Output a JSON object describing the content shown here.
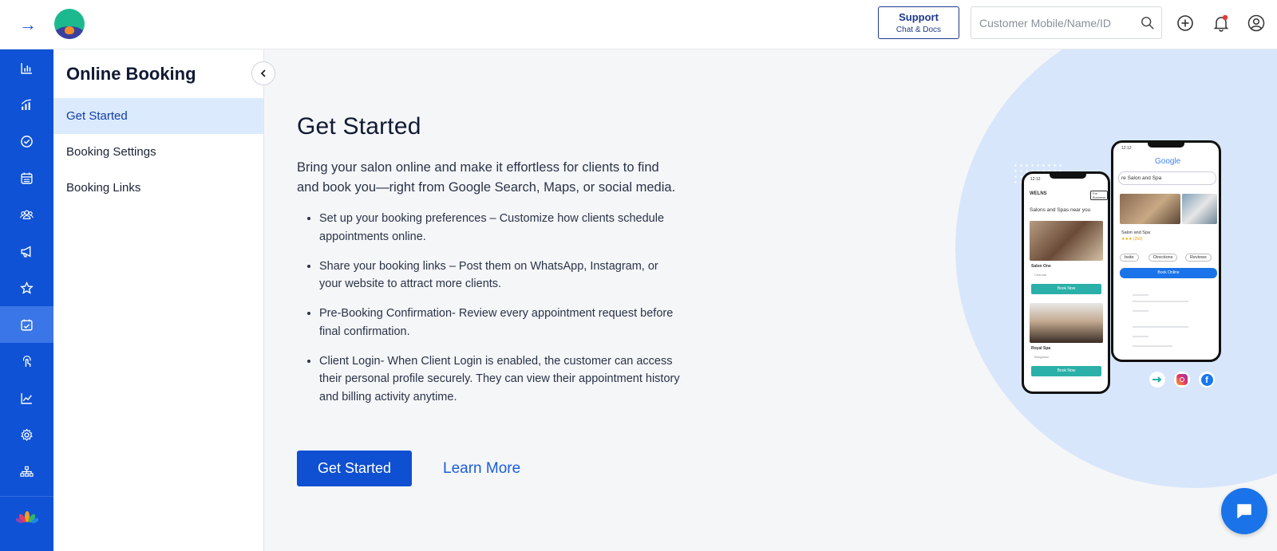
{
  "header": {
    "support_title": "Support",
    "support_sub": "Chat & Docs",
    "search_placeholder": "Customer Mobile/Name/ID",
    "icons": [
      "arrow-right-icon",
      "app-logo",
      "search-icon",
      "add-circle-icon",
      "bell-icon",
      "user-icon"
    ],
    "notification_dot_color": "#e53935"
  },
  "sidebar": {
    "icons": [
      "bar-chart-icon",
      "analytics-icon",
      "check-circle-icon",
      "calendar-icon",
      "clients-icon",
      "megaphone-icon",
      "star-icon",
      "calendar-check-icon",
      "touch-icon",
      "trend-icon",
      "settings-icon",
      "org-chart-icon",
      "lotus-logo"
    ],
    "active": "calendar-check-icon"
  },
  "subnav": {
    "title": "Online Booking",
    "items": [
      {
        "label": "Get Started",
        "active": true
      },
      {
        "label": "Booking Settings",
        "active": false
      },
      {
        "label": "Booking Links",
        "active": false
      }
    ]
  },
  "main": {
    "title": "Get Started",
    "intro": "Bring your salon online and make it effortless for clients to find and book you—right from Google Search, Maps, or social media.",
    "bullets": [
      "Set up your booking preferences – Customize how clients schedule appointments online.",
      "Share your booking links – Post them on WhatsApp, Instagram, or your website to attract more clients.",
      "Pre-Booking Confirmation- Review every appointment request before final confirmation.",
      "Client Login- When Client Login is enabled, the customer can access their personal profile securely. They can view their appointment history and billing activity anytime."
    ],
    "primary_button": "Get Started",
    "secondary_link": "Learn More"
  },
  "illustration": {
    "front_phone": {
      "time": "12:12",
      "brand": "WELNS",
      "badge": "For Business",
      "heading": "Salons and Spas near you",
      "listings": [
        {
          "name": "Salon One",
          "location": "Chennai",
          "button": "Book Now"
        },
        {
          "name": "Royal Spa",
          "location": "Bangalore",
          "button": "Book Now"
        }
      ]
    },
    "back_phone": {
      "time": "12:12",
      "search_brand": "Google",
      "query": "re Salon and Spa",
      "result_name": "Salon and Spa",
      "rating_text": "★★★ (250)",
      "chips": [
        "bsite",
        "Directions",
        "Reviews"
      ],
      "cta": "Book Online"
    },
    "social_icons": [
      "welns-icon",
      "instagram-icon",
      "facebook-icon"
    ]
  },
  "colors": {
    "brand_blue": "#0f52d6",
    "active_nav_bg": "#dceafd",
    "teal_button": "#2ab0a8",
    "google_blue": "#1a73e8"
  }
}
